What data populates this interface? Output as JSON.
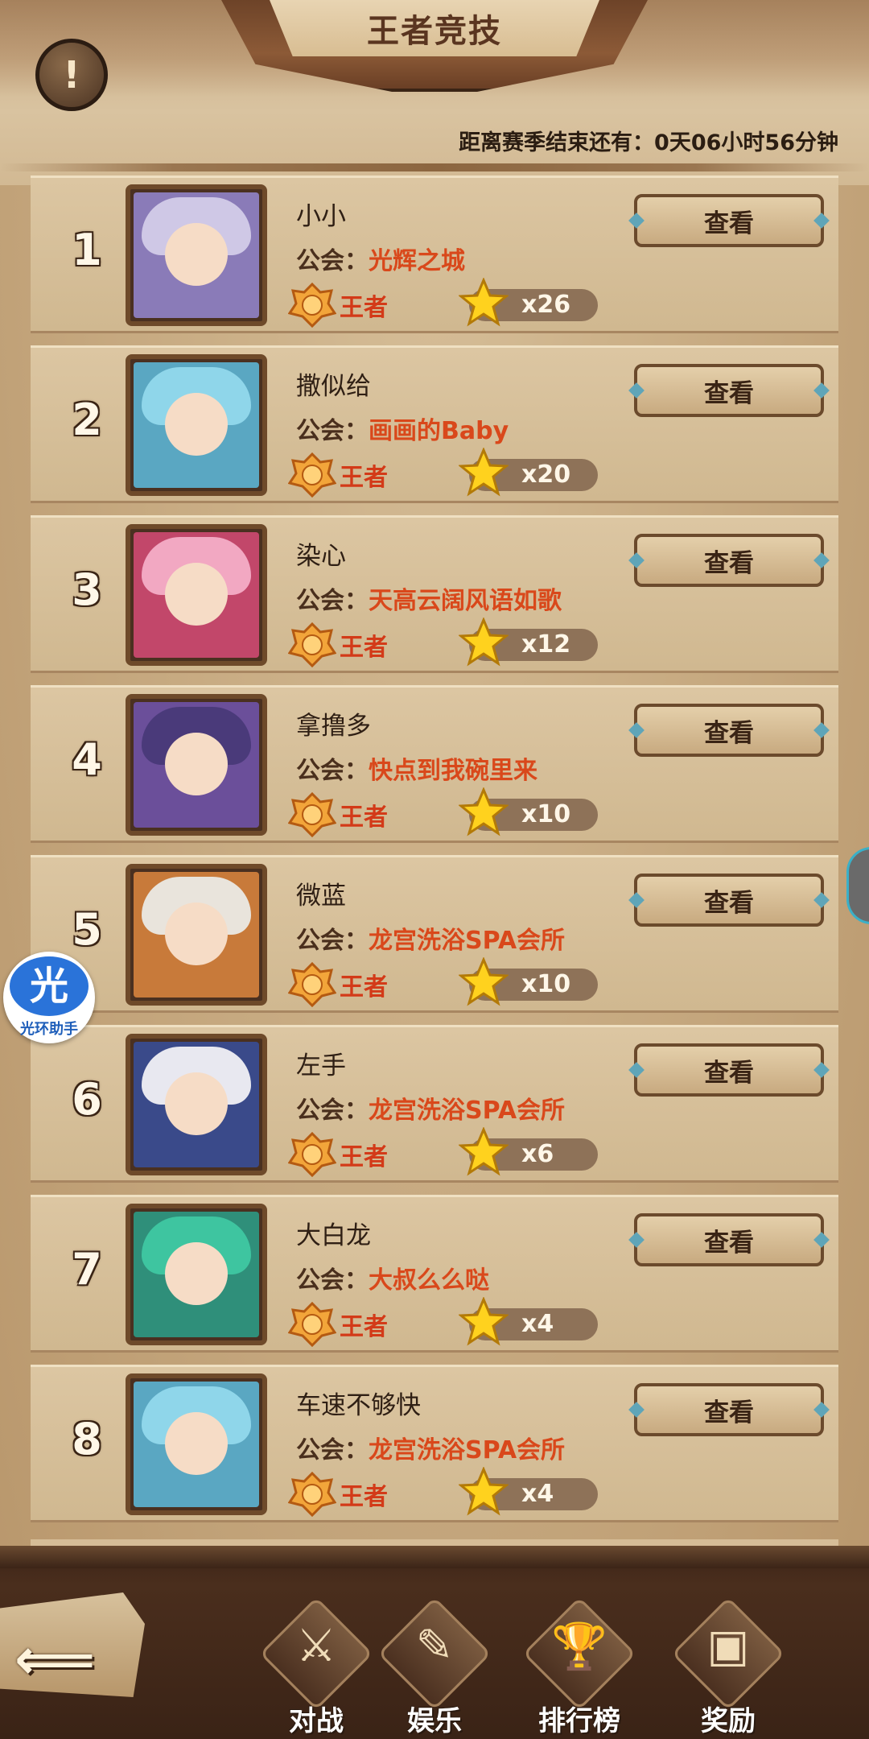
{
  "header": {
    "title": "王者竞技",
    "season_text": "距离赛季结束还有：0天06小时56分钟"
  },
  "alert_icon_label": "!",
  "rank_list": [
    {
      "rank": "1",
      "name": "小小",
      "guild_label": "公会：",
      "guild": "光辉之城",
      "tier": "王者",
      "stars": "x26",
      "view": "查看",
      "hair": "#cfc8e6",
      "art": "#8a7bb8"
    },
    {
      "rank": "2",
      "name": "撒似给",
      "guild_label": "公会：",
      "guild": "画画的Baby",
      "tier": "王者",
      "stars": "x20",
      "view": "查看",
      "hair": "#8fd6ea",
      "art": "#5aa7c2"
    },
    {
      "rank": "3",
      "name": "染心",
      "guild_label": "公会：",
      "guild": "天高云阔风语如歌",
      "tier": "王者",
      "stars": "x12",
      "view": "查看",
      "hair": "#f2a8c2",
      "art": "#c2476a"
    },
    {
      "rank": "4",
      "name": "拿撸多",
      "guild_label": "公会：",
      "guild": "快点到我碗里来",
      "tier": "王者",
      "stars": "x10",
      "view": "查看",
      "hair": "#4a3a7a",
      "art": "#6b4f9a"
    },
    {
      "rank": "5",
      "name": "微蓝",
      "guild_label": "公会：",
      "guild": "龙宫洗浴SPA会所",
      "tier": "王者",
      "stars": "x10",
      "view": "查看",
      "hair": "#e9e4dc",
      "art": "#c87a3a"
    },
    {
      "rank": "6",
      "name": "左手",
      "guild_label": "公会：",
      "guild": "龙宫洗浴SPA会所",
      "tier": "王者",
      "stars": "x6",
      "view": "查看",
      "hair": "#e8e8f0",
      "art": "#3a4a8a"
    },
    {
      "rank": "7",
      "name": "大白龙",
      "guild_label": "公会：",
      "guild": "大叔么么哒",
      "tier": "王者",
      "stars": "x4",
      "view": "查看",
      "hair": "#3ec5a0",
      "art": "#2f8f7a"
    },
    {
      "rank": "8",
      "name": "车速不够快",
      "guild_label": "公会：",
      "guild": "龙宫洗浴SPA会所",
      "tier": "王者",
      "stars": "x4",
      "view": "查看",
      "hair": "#8fd6ea",
      "art": "#5aa7c2"
    }
  ],
  "bottom_nav": [
    {
      "label": "对战",
      "icon": "battle-icon",
      "glyph": "⚔"
    },
    {
      "label": "娱乐",
      "icon": "entertainment-icon",
      "glyph": "✎"
    },
    {
      "label": "排行榜",
      "icon": "trophy-icon",
      "glyph": "🏆"
    },
    {
      "label": "奖励",
      "icon": "treasure-chest-icon",
      "glyph": "▣"
    }
  ],
  "assistant_badge": {
    "char": "光",
    "label": "光环助手"
  }
}
